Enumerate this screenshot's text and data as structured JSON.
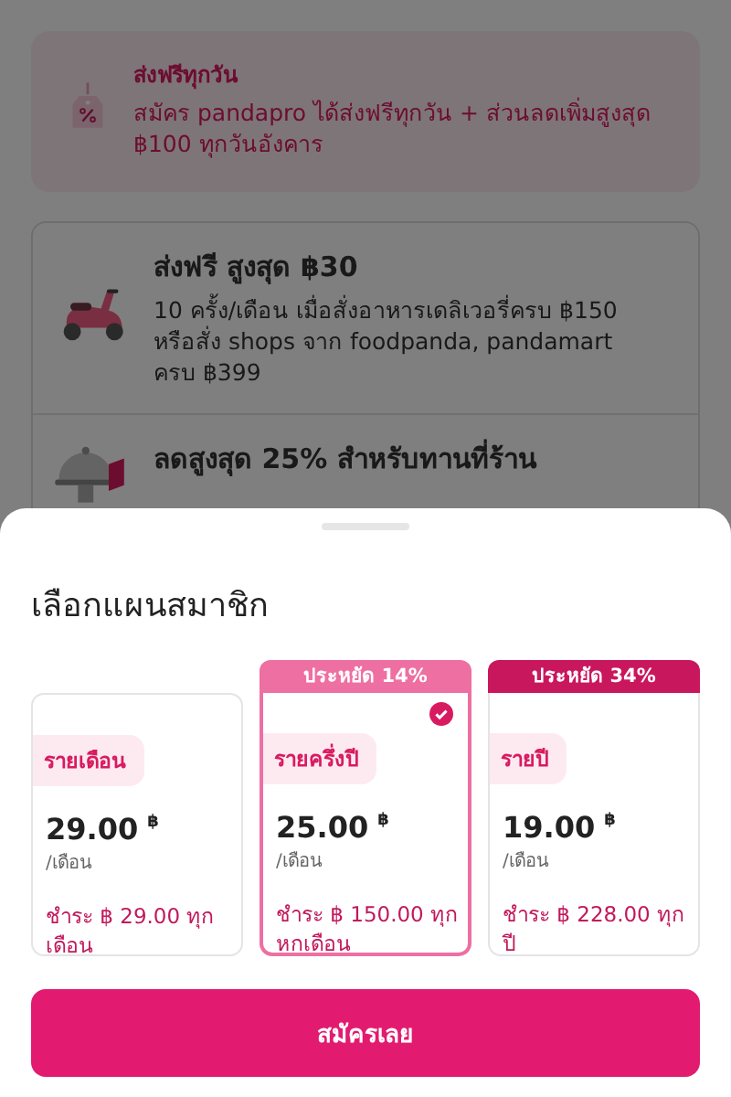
{
  "banner": {
    "title": "ส่งฟรีทุกวัน",
    "text": "สมัคร pandapro ได้ส่งฟรีทุกวัน + ส่วนลดเพิ่มสูงสุด ฿100 ทุกวันอังคาร"
  },
  "benefits": [
    {
      "kind": "scooter",
      "title": "ส่งฟรี สูงสุด ฿30",
      "text": "10 ครั้ง/เดือน เมื่อสั่งอาหารเดลิเวอรี่ครบ ฿150 หรือสั่ง shops จาก foodpanda, pandamart ครบ ฿399"
    },
    {
      "kind": "cloche",
      "title": "ลดสูงสุด 25% สำหรับทานที่ร้าน"
    }
  ],
  "sheet": {
    "title": "เลือกแผนสมาชิก",
    "plans": [
      {
        "name": "รายเดือน",
        "price": "29.00",
        "currency": "฿",
        "unit": "/เดือน",
        "billing": "ชำระ ฿ 29.00 ทุกเดือน",
        "selected": false
      },
      {
        "name": "รายครึ่งปี",
        "price": "25.00",
        "currency": "฿",
        "unit": "/เดือน",
        "billing": "ชำระ ฿ 150.00 ทุกหกเดือน",
        "selected": true,
        "badge": {
          "text": "ประหยัด 14%",
          "color": "#ee6fa2"
        }
      },
      {
        "name": "รายปี",
        "price": "19.00",
        "currency": "฿",
        "unit": "/เดือน",
        "billing": "ชำระ ฿ 228.00 ทุกปี",
        "selected": false,
        "badge": {
          "text": "ประหยัด 34%",
          "color": "#c9175e"
        }
      }
    ]
  },
  "cta": "สมัครเลย"
}
